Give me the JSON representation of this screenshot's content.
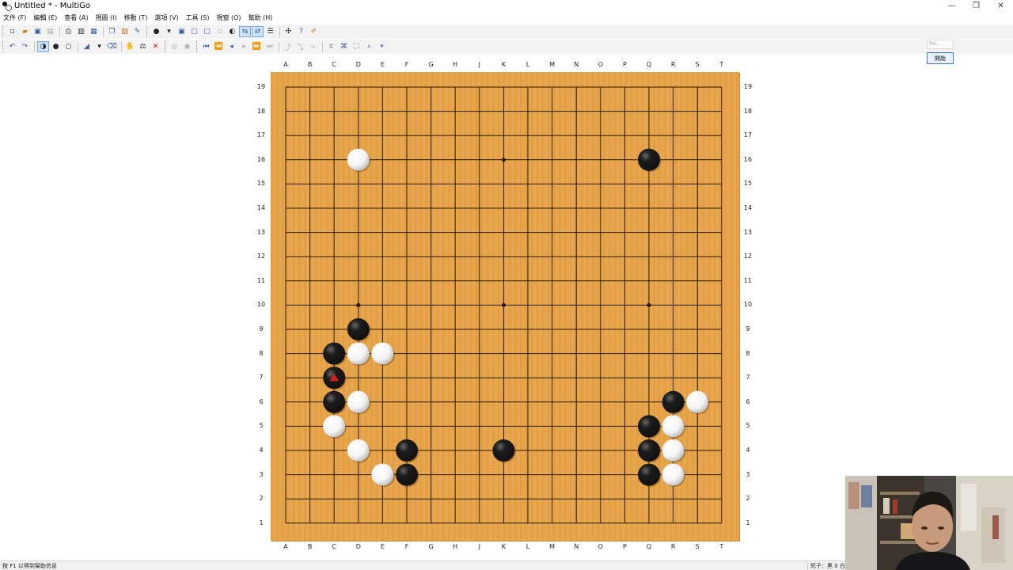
{
  "window": {
    "title": "Untitled * - MultiGo",
    "minimize_glyph": "—",
    "maximize_glyph": "❐",
    "close_glyph": "✕"
  },
  "menu": [
    {
      "label": "文件 (F)"
    },
    {
      "label": "編輯 (E)"
    },
    {
      "label": "查看 (A)"
    },
    {
      "label": "視圖 (I)"
    },
    {
      "label": "移動 (T)"
    },
    {
      "label": "選項 (V)"
    },
    {
      "label": "工具 (S)"
    },
    {
      "label": "視窗 (O)"
    },
    {
      "label": "幫助 (H)"
    }
  ],
  "toolbar1": [
    {
      "icon": "new-file-icon",
      "glyph": "▫"
    },
    {
      "icon": "open-folder-icon",
      "glyph": "▰"
    },
    {
      "icon": "save-icon",
      "glyph": "▣"
    },
    {
      "icon": "save-as-icon",
      "glyph": "▤"
    },
    {
      "icon": "print-icon",
      "glyph": "⎙"
    },
    {
      "icon": "print-preview-icon",
      "glyph": "▥"
    },
    {
      "icon": "export-icon",
      "glyph": "▦"
    },
    {
      "icon": "copy-icon",
      "glyph": "❐"
    },
    {
      "icon": "paste-icon",
      "glyph": "▧"
    },
    {
      "icon": "game-info-icon",
      "glyph": "✎"
    },
    {
      "icon": "stone-menu-icon",
      "glyph": "●"
    },
    {
      "icon": "dropdown-arrow-icon",
      "glyph": "▾"
    },
    {
      "icon": "board-view-icon",
      "glyph": "▣"
    },
    {
      "icon": "window-icon",
      "glyph": "▢"
    },
    {
      "icon": "window-split-icon",
      "glyph": "▢"
    },
    {
      "icon": "blank-window-icon",
      "glyph": "▫"
    },
    {
      "icon": "coordinate-icon",
      "glyph": "◐"
    },
    {
      "icon": "text-mode-icon",
      "glyph": "⇆"
    },
    {
      "icon": "text-mode-2-icon",
      "glyph": "⇄"
    },
    {
      "icon": "list-icon",
      "glyph": "☰"
    },
    {
      "icon": "tools-icon",
      "glyph": "✣"
    },
    {
      "icon": "help-query-icon",
      "glyph": "?"
    },
    {
      "icon": "pencil-icon",
      "glyph": "✐"
    }
  ],
  "toolbar2": [
    {
      "icon": "undo-icon",
      "glyph": "↶"
    },
    {
      "icon": "redo-icon",
      "glyph": "↷"
    },
    {
      "icon": "alternate-stones-icon",
      "glyph": "◑"
    },
    {
      "icon": "black-stone-icon",
      "glyph": "●"
    },
    {
      "icon": "white-stone-icon",
      "glyph": "○"
    },
    {
      "icon": "mark-icon",
      "glyph": "◢"
    },
    {
      "icon": "mark-dropdown-icon",
      "glyph": "▾"
    },
    {
      "icon": "eraser-icon",
      "glyph": "⌫"
    },
    {
      "icon": "hand-icon",
      "glyph": "✋"
    },
    {
      "icon": "score-icon",
      "glyph": "⚖"
    },
    {
      "icon": "delete-icon",
      "glyph": "✕"
    },
    {
      "icon": "pass-icon",
      "glyph": "◎"
    },
    {
      "icon": "resign-icon",
      "glyph": "◉"
    },
    {
      "icon": "first-move-icon",
      "glyph": "⏮"
    },
    {
      "icon": "back-ten-icon",
      "glyph": "⏪"
    },
    {
      "icon": "back-icon",
      "glyph": "◂"
    },
    {
      "icon": "forward-icon",
      "glyph": "▸"
    },
    {
      "icon": "forward-ten-icon",
      "glyph": "⏩"
    },
    {
      "icon": "last-move-icon",
      "glyph": "⏭"
    },
    {
      "icon": "branch-up-icon",
      "glyph": "⤴"
    },
    {
      "icon": "branch-icon",
      "glyph": "⤵"
    },
    {
      "icon": "branch-down-icon",
      "glyph": "⤷"
    },
    {
      "icon": "tree-icon",
      "glyph": "⌗"
    },
    {
      "icon": "tree-2-icon",
      "glyph": "⌘"
    },
    {
      "icon": "find-icon",
      "glyph": "⛶"
    },
    {
      "icon": "find-2-icon",
      "glyph": "⌕"
    },
    {
      "icon": "find-3-icon",
      "glyph": "⌖"
    }
  ],
  "mini_panel": {
    "input_placeholder": "Poi...",
    "button_label": "開始"
  },
  "board": {
    "size": 19,
    "columns": [
      "A",
      "B",
      "C",
      "D",
      "E",
      "F",
      "G",
      "H",
      "J",
      "K",
      "L",
      "M",
      "N",
      "O",
      "P",
      "Q",
      "R",
      "S",
      "T"
    ],
    "rows": [
      "19",
      "18",
      "17",
      "16",
      "15",
      "14",
      "13",
      "12",
      "11",
      "10",
      "9",
      "8",
      "7",
      "6",
      "5",
      "4",
      "3",
      "2",
      "1"
    ],
    "star_points": [
      "D16",
      "K16",
      "Q16",
      "D10",
      "K10",
      "Q10",
      "D4",
      "K4",
      "Q4"
    ],
    "stones": [
      {
        "point": "D16",
        "color": "white"
      },
      {
        "point": "Q16",
        "color": "black"
      },
      {
        "point": "D9",
        "color": "black"
      },
      {
        "point": "C8",
        "color": "black"
      },
      {
        "point": "D8",
        "color": "white"
      },
      {
        "point": "E8",
        "color": "white"
      },
      {
        "point": "C7",
        "color": "black",
        "last_move": true
      },
      {
        "point": "C6",
        "color": "black"
      },
      {
        "point": "D6",
        "color": "white"
      },
      {
        "point": "C5",
        "color": "white"
      },
      {
        "point": "D4",
        "color": "white"
      },
      {
        "point": "F4",
        "color": "black"
      },
      {
        "point": "E3",
        "color": "white"
      },
      {
        "point": "F3",
        "color": "black"
      },
      {
        "point": "K4",
        "color": "black"
      },
      {
        "point": "R6",
        "color": "black"
      },
      {
        "point": "S6",
        "color": "white"
      },
      {
        "point": "Q5",
        "color": "black"
      },
      {
        "point": "R5",
        "color": "white"
      },
      {
        "point": "Q4",
        "color": "black"
      },
      {
        "point": "R4",
        "color": "white"
      },
      {
        "point": "Q3",
        "color": "black"
      },
      {
        "point": "R3",
        "color": "white"
      }
    ],
    "colors": {
      "wood": "#e7a449",
      "line": "#2b1a08",
      "black_stone": "#111111",
      "white_stone": "#f4f4f4",
      "last_move_marker": "#d81b1b"
    }
  },
  "status": {
    "hint": "按 F1 以得到幫助信息",
    "captures": "死子：黑 0 白"
  }
}
